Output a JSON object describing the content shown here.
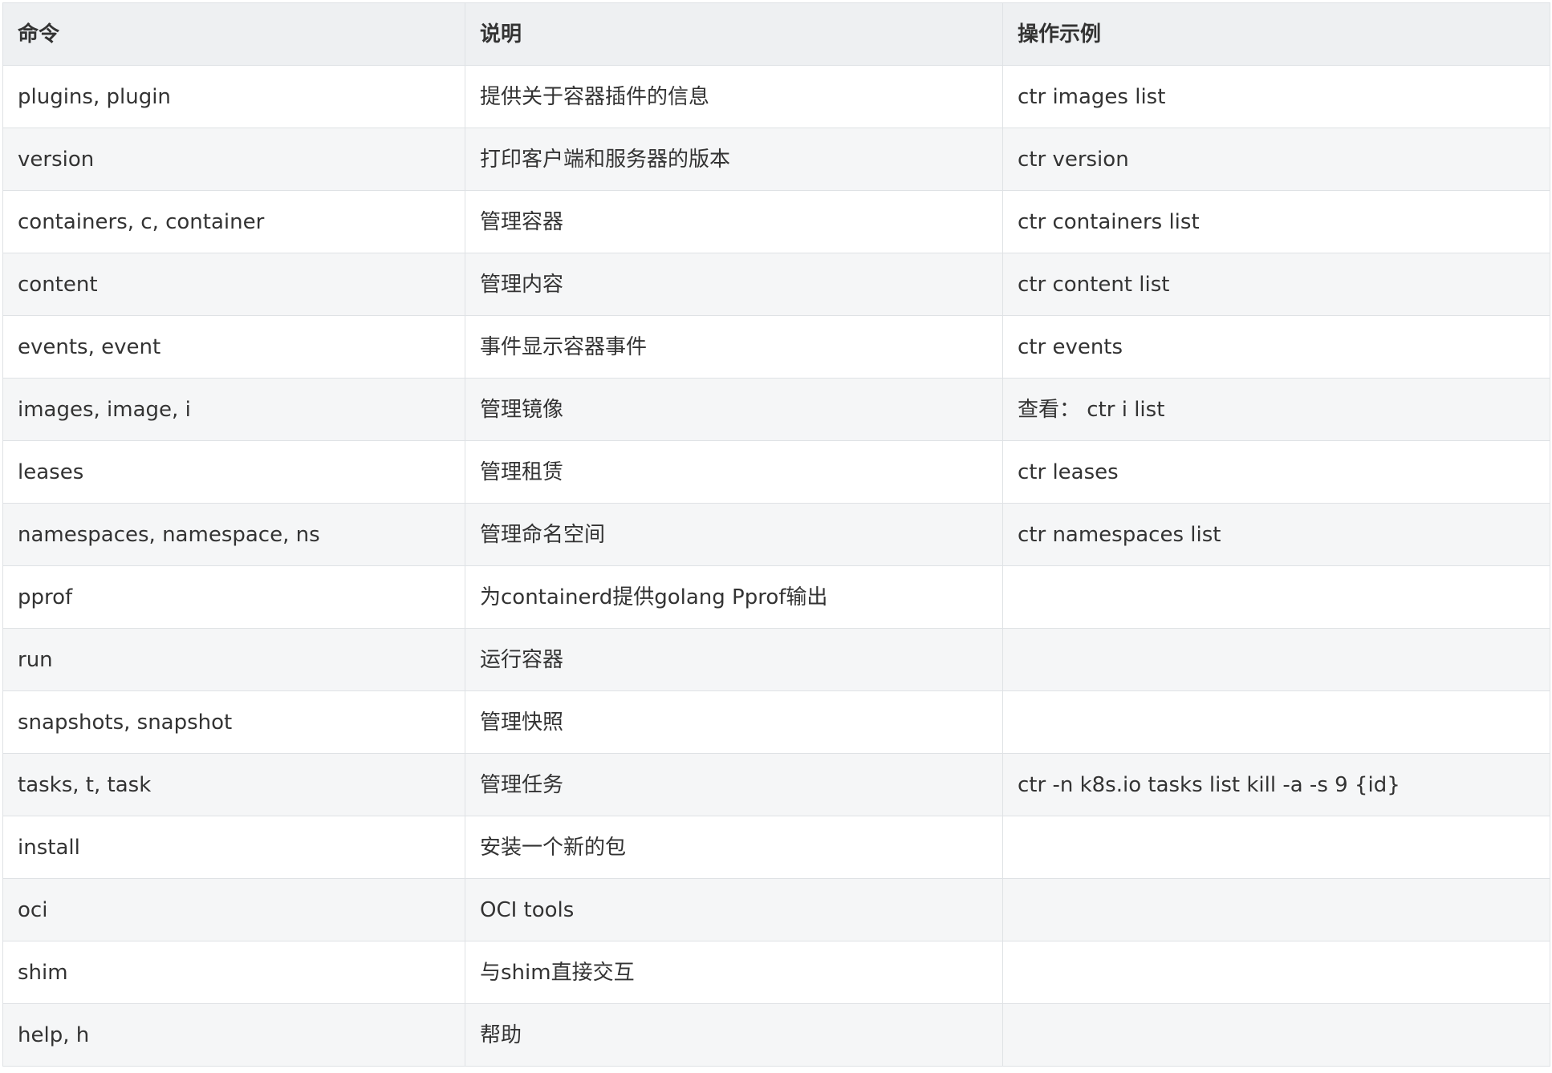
{
  "table": {
    "headers": [
      "命令",
      "说明",
      "操作示例"
    ],
    "rows": [
      [
        "plugins, plugin",
        "提供关于容器插件的信息",
        "ctr images list"
      ],
      [
        "version",
        "打印客户端和服务器的版本",
        "ctr version"
      ],
      [
        "containers, c, container",
        "管理容器",
        "ctr containers list"
      ],
      [
        "content",
        "管理内容",
        "ctr content list"
      ],
      [
        "events, event",
        "事件显示容器事件",
        "ctr events"
      ],
      [
        "images, image, i",
        "管理镜像",
        "查看： ctr i list"
      ],
      [
        "leases",
        "管理租赁",
        "ctr leases"
      ],
      [
        "namespaces, namespace, ns",
        "管理命名空间",
        "ctr namespaces list"
      ],
      [
        "pprof",
        "为containerd提供golang Pprof输出",
        ""
      ],
      [
        "run",
        "运行容器",
        ""
      ],
      [
        "snapshots, snapshot",
        "管理快照",
        ""
      ],
      [
        "tasks, t, task",
        "管理任务",
        "ctr -n k8s.io tasks list kill -a -s 9 {id}"
      ],
      [
        "install",
        "安装一个新的包",
        ""
      ],
      [
        "oci",
        "OCI tools",
        ""
      ],
      [
        "shim",
        "与shim直接交互",
        ""
      ],
      [
        "help, h",
        "帮助",
        ""
      ]
    ]
  },
  "colors": {
    "header_bg": "#eef0f2",
    "row_alt_bg": "#f5f6f7",
    "border": "#dfe2e5",
    "text": "#333333"
  }
}
